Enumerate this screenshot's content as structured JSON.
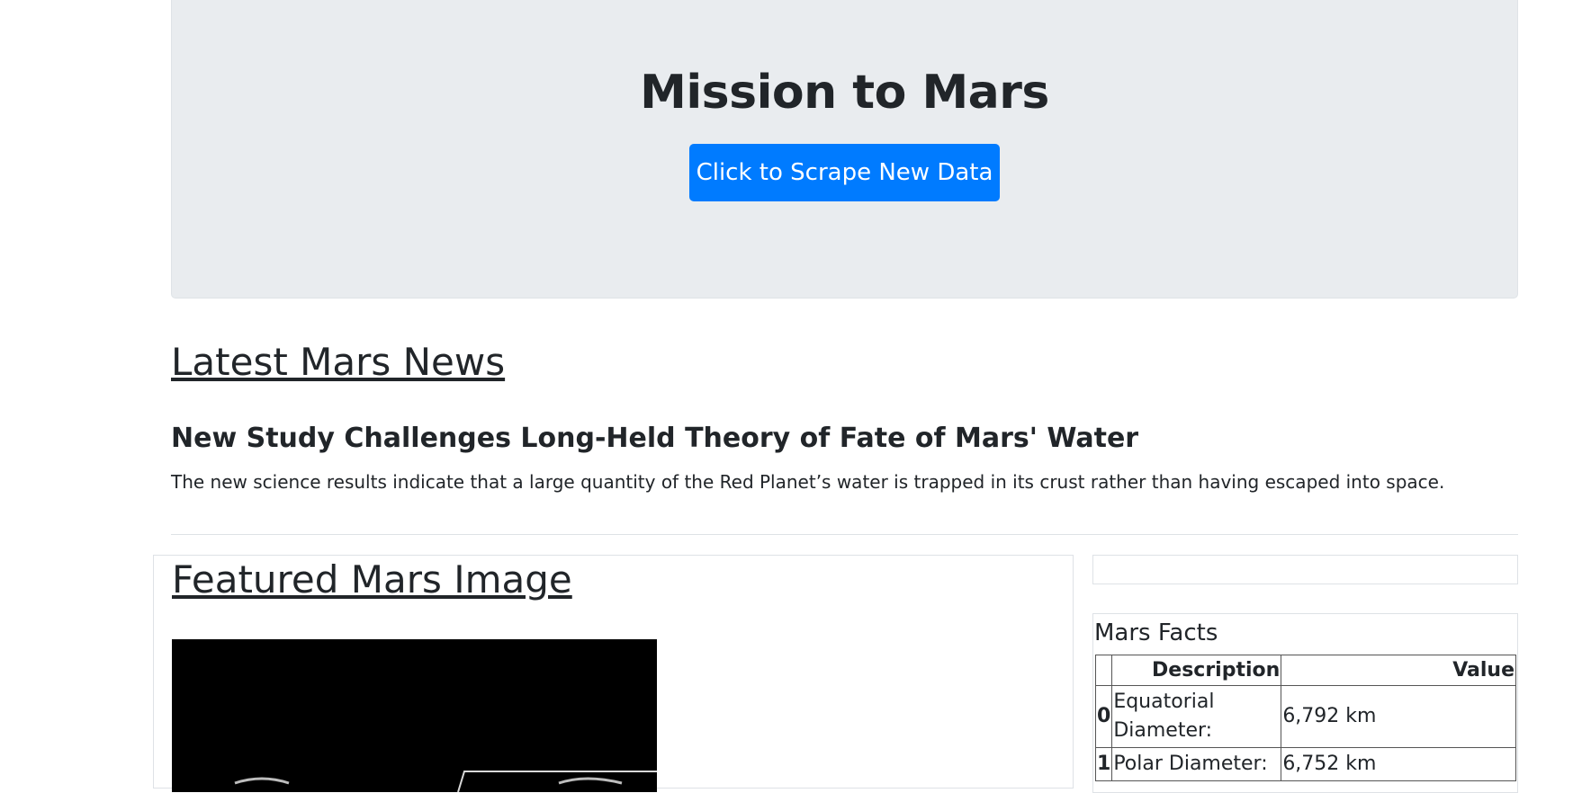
{
  "header": {
    "title": "Mission to Mars",
    "scrape_button_label": "Click to Scrape New Data"
  },
  "news": {
    "section_heading": "Latest Mars News",
    "title": "New Study Challenges Long-Held Theory of Fate of Mars' Water",
    "paragraph": "The new science results indicate that a large quantity of the Red Planet’s water is trapped in its crust rather than having escaped into space."
  },
  "featured": {
    "section_heading": "Featured Mars Image"
  },
  "facts": {
    "heading": "Mars Facts",
    "columns": [
      "",
      "Description",
      "Value"
    ],
    "rows": [
      {
        "index": "0",
        "description": "Equatorial Diameter:",
        "value": "6,792 km"
      },
      {
        "index": "1",
        "description": "Polar Diameter:",
        "value": "6,752 km"
      }
    ]
  },
  "colors": {
    "jumbotron_bg": "#e9ecef",
    "button_primary": "#007bff",
    "text": "#212529"
  }
}
